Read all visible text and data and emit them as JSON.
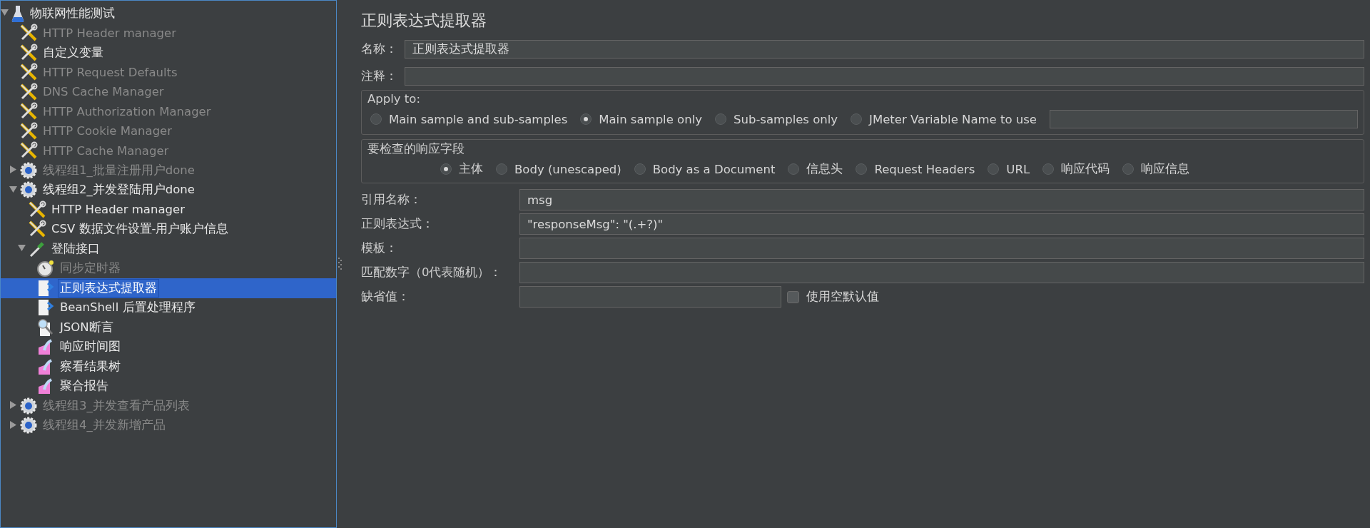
{
  "tree": [
    {
      "label": "物联网性能测试",
      "kind": "testplan",
      "disabled": false,
      "selected": false,
      "expanded": true,
      "children": [
        {
          "label": "HTTP Header manager",
          "kind": "config",
          "disabled": true,
          "selected": false
        },
        {
          "label": "自定义变量",
          "kind": "config",
          "disabled": false,
          "selected": false
        },
        {
          "label": "HTTP Request Defaults",
          "kind": "config",
          "disabled": true,
          "selected": false
        },
        {
          "label": "DNS Cache Manager",
          "kind": "config",
          "disabled": true,
          "selected": false
        },
        {
          "label": "HTTP Authorization Manager",
          "kind": "config",
          "disabled": true,
          "selected": false
        },
        {
          "label": "HTTP Cookie Manager",
          "kind": "config",
          "disabled": true,
          "selected": false
        },
        {
          "label": "HTTP Cache Manager",
          "kind": "config",
          "disabled": true,
          "selected": false
        },
        {
          "label": "线程组1_批量注册用户done",
          "kind": "threadgroup",
          "disabled": true,
          "selected": false,
          "expanded": false
        },
        {
          "label": "线程组2_并发登陆用户done",
          "kind": "threadgroup",
          "disabled": false,
          "selected": false,
          "expanded": true,
          "children": [
            {
              "label": "HTTP Header manager",
              "kind": "config",
              "disabled": false,
              "selected": false
            },
            {
              "label": "CSV 数据文件设置-用户账户信息",
              "kind": "config",
              "disabled": false,
              "selected": false
            },
            {
              "label": "登陆接口",
              "kind": "sampler",
              "disabled": false,
              "selected": false,
              "expanded": true,
              "children": [
                {
                  "label": "同步定时器",
                  "kind": "timer",
                  "disabled": true,
                  "selected": false
                },
                {
                  "label": "正则表达式提取器",
                  "kind": "postprocessor",
                  "disabled": false,
                  "selected": true
                },
                {
                  "label": "BeanShell 后置处理程序",
                  "kind": "postprocessor",
                  "disabled": false,
                  "selected": false
                },
                {
                  "label": "JSON断言",
                  "kind": "assertion",
                  "disabled": false,
                  "selected": false
                },
                {
                  "label": "响应时间图",
                  "kind": "listener",
                  "disabled": false,
                  "selected": false
                },
                {
                  "label": "察看结果树",
                  "kind": "listener",
                  "disabled": false,
                  "selected": false
                },
                {
                  "label": "聚合报告",
                  "kind": "listener",
                  "disabled": false,
                  "selected": false
                }
              ]
            }
          ]
        },
        {
          "label": "线程组3_并发查看产品列表",
          "kind": "threadgroup",
          "disabled": true,
          "selected": false,
          "expanded": false
        },
        {
          "label": "线程组4_并发新增产品",
          "kind": "threadgroup",
          "disabled": true,
          "selected": false,
          "expanded": false
        }
      ]
    }
  ],
  "editor": {
    "title": "正则表达式提取器",
    "name": {
      "label": "名称：",
      "value": "正则表达式提取器"
    },
    "comment": {
      "label": "注释："
    },
    "apply_to": {
      "legend": "Apply to:",
      "options": [
        {
          "label": "Main sample and sub-samples",
          "selected": false
        },
        {
          "label": "Main sample only",
          "selected": true
        },
        {
          "label": "Sub-samples only",
          "selected": false
        },
        {
          "label": "JMeter Variable Name to use",
          "selected": false
        }
      ]
    },
    "field_to_check": {
      "legend": "要检查的响应字段",
      "options": [
        {
          "label": "主体",
          "selected": true
        },
        {
          "label": "Body (unescaped)",
          "selected": false
        },
        {
          "label": "Body as a Document",
          "selected": false
        },
        {
          "label": "信息头",
          "selected": false
        },
        {
          "label": "Request Headers",
          "selected": false
        },
        {
          "label": "URL",
          "selected": false
        },
        {
          "label": "响应代码",
          "selected": false
        },
        {
          "label": "响应信息",
          "selected": false
        }
      ]
    },
    "params": [
      {
        "label": "引用名称：",
        "value": "msg"
      },
      {
        "label": "正则表达式：",
        "value": "\"responseMsg\": \"(.+?)\""
      },
      {
        "label": "模板："
      },
      {
        "label": "匹配数字（0代表随机）："
      }
    ],
    "default": {
      "label": "缺省值：",
      "checkbox": {
        "label": "使用空默认值",
        "checked": false
      }
    }
  }
}
